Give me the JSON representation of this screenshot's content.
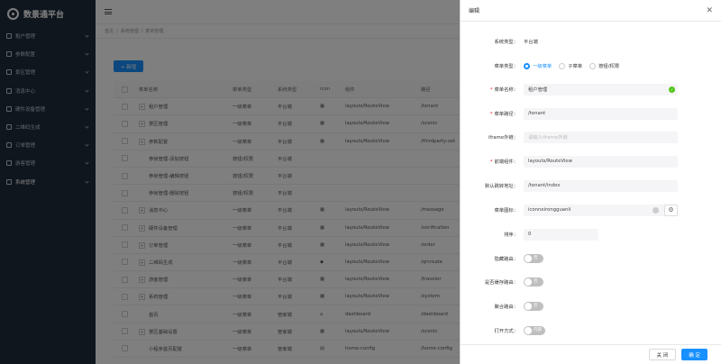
{
  "app": {
    "title": "数景通平台"
  },
  "sidebar": {
    "items": [
      {
        "label": "租户管理"
      },
      {
        "label": "参数配置"
      },
      {
        "label": "景区管理"
      },
      {
        "label": "消息中心"
      },
      {
        "label": "硬件设备管理"
      },
      {
        "label": "二维码生成"
      },
      {
        "label": "订单管理"
      },
      {
        "label": "游客管理"
      },
      {
        "label": "系统管理"
      }
    ]
  },
  "breadcrumb": [
    "首页",
    "/",
    "系统管理",
    "/",
    "菜单管理"
  ],
  "toolbar": {
    "add_label": "+ 新增"
  },
  "table": {
    "headers": [
      "菜单名称",
      "菜单类型",
      "系统类型",
      "icon",
      "组件",
      "路径"
    ],
    "rows": [
      {
        "name": "租户管理",
        "type": "一级菜单",
        "sys": "平台端",
        "icon": "grid",
        "comp": "layouts/RouteView",
        "path": "/tenant",
        "expand": true
      },
      {
        "name": "景区管理",
        "type": "一级菜单",
        "sys": "平台端",
        "icon": "grid",
        "comp": "layouts/RouteView",
        "path": "/scenic",
        "expand": true
      },
      {
        "name": "参数配置",
        "type": "一级菜单",
        "sys": "平台端",
        "icon": "grid",
        "comp": "layouts/RouteView",
        "path": "/thirdparty-set",
        "expand": true
      },
      {
        "name": "参帧管理-添加按钮",
        "type": "按钮/权限",
        "sys": "平台端",
        "icon": "",
        "comp": "",
        "path": "",
        "expand": false
      },
      {
        "name": "参帧管理-编辑按钮",
        "type": "按钮/权限",
        "sys": "平台端",
        "icon": "",
        "comp": "",
        "path": "",
        "expand": false
      },
      {
        "name": "参帧管理-删除按钮",
        "type": "按钮/权限",
        "sys": "平台端",
        "icon": "",
        "comp": "",
        "path": "",
        "expand": false
      },
      {
        "name": "消息中心",
        "type": "一级菜单",
        "sys": "平台端",
        "icon": "grid",
        "comp": "layouts/RouteView",
        "path": "/message",
        "expand": true
      },
      {
        "name": "硬件设备管理",
        "type": "一级菜单",
        "sys": "平台端",
        "icon": "grid",
        "comp": "layouts/RouteView",
        "path": "/verification",
        "expand": true
      },
      {
        "name": "订单管理",
        "type": "一级菜单",
        "sys": "平台端",
        "icon": "grid",
        "comp": "layouts/RouteView",
        "path": "/order",
        "expand": true
      },
      {
        "name": "二维码生成",
        "type": "一级菜单",
        "sys": "平台端",
        "icon": "diamond",
        "comp": "layouts/RouteView",
        "path": "/qrcreate",
        "expand": true
      },
      {
        "name": "游客管理",
        "type": "一级菜单",
        "sys": "平台端",
        "icon": "grid",
        "comp": "layouts/RouteView",
        "path": "/traveler",
        "expand": true
      },
      {
        "name": "系统管理",
        "type": "一级菜单",
        "sys": "平台端",
        "icon": "grid",
        "comp": "layouts/RouteView",
        "path": "/system",
        "expand": true
      },
      {
        "name": "首页",
        "type": "一级菜单",
        "sys": "管家端",
        "icon": "home",
        "comp": "dashboard",
        "path": "/dashboard",
        "expand": false
      },
      {
        "name": "景区基础设置",
        "type": "一级菜单",
        "sys": "管家端",
        "icon": "grid",
        "comp": "layouts/RouteView",
        "path": "/scenic",
        "expand": true
      },
      {
        "name": "小程序首页配置",
        "type": "一级菜单",
        "sys": "管家端",
        "icon": "doc",
        "comp": "home-config",
        "path": "/home-config",
        "expand": false
      }
    ]
  },
  "drawer": {
    "title": "编辑",
    "sys_type_label": "系统类型：",
    "sys_type_value": "平台端",
    "menu_type_label": "菜单类型：",
    "menu_type_options": [
      "一级菜单",
      "子菜单",
      "按钮/权限"
    ],
    "menu_type_selected": 0,
    "name_label": "菜单名称：",
    "name_value": "租户管理",
    "path_label": "菜单路径：",
    "path_value": "/tenant",
    "iframe_label": "iframe外链：",
    "iframe_placeholder": "请输入iframe外链",
    "component_label": "前端组件：",
    "component_value": "layouts/RouteView",
    "redirect_label": "默认跳转地址：",
    "redirect_value": "/tenant/index",
    "icon_label": "菜单图标：",
    "icon_value": "iconneirongguanli",
    "sort_label": "排序：",
    "sort_value": "0",
    "hidden_label": "隐藏路由：",
    "hidden_value": "否",
    "cache_label": "是否缓存路由：",
    "cache_value": "否",
    "aggregate_label": "聚合路由：",
    "aggregate_value": "否",
    "open_label": "打开方式：",
    "open_value": "内部",
    "close_btn": "关 闭",
    "confirm_btn": "确 定"
  }
}
